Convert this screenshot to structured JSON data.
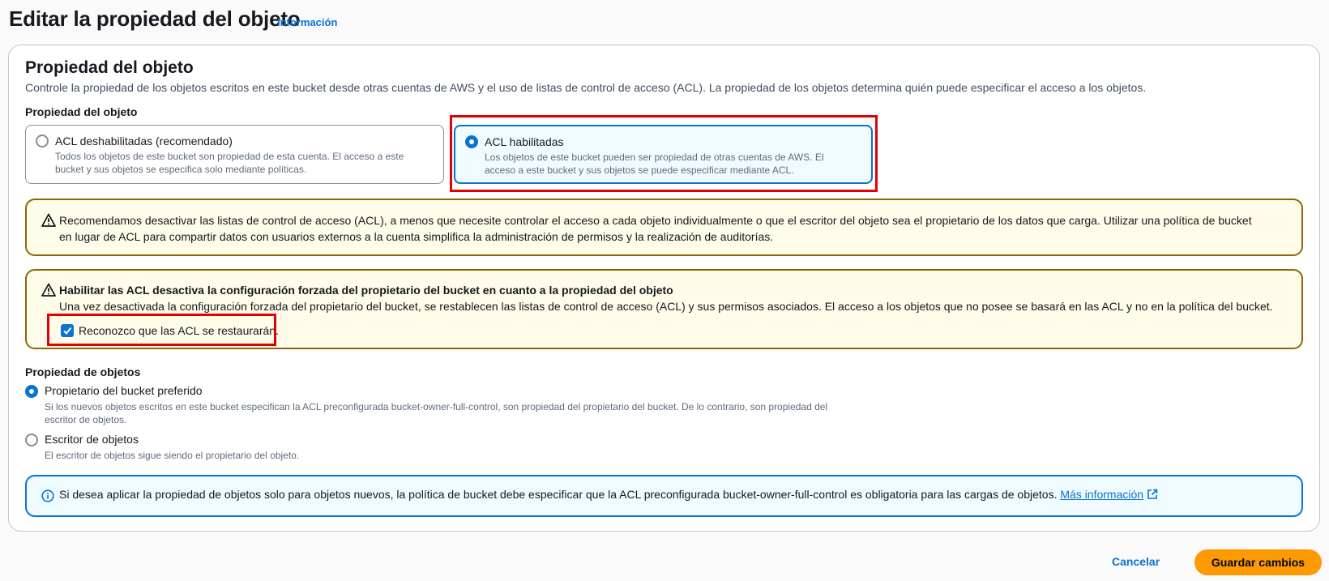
{
  "header": {
    "title": "Editar la propiedad del objeto",
    "info_link": "Información"
  },
  "section": {
    "title": "Propiedad del objeto",
    "description": "Controle la propiedad de los objetos escritos en este bucket desde otras cuentas de AWS y el uso de listas de control de acceso (ACL). La propiedad de los objetos determina quién puede especificar el acceso a los objetos."
  },
  "ownership": {
    "label": "Propiedad del objeto",
    "options": [
      {
        "title": "ACL deshabilitadas (recomendado)",
        "description": "Todos los objetos de este bucket son propiedad de esta cuenta. El acceso a este bucket y sus objetos se especifica solo mediante políticas.",
        "selected": false
      },
      {
        "title": "ACL habilitadas",
        "description": "Los objetos de este bucket pueden ser propiedad de otras cuentas de AWS. El acceso a este bucket y sus objetos se puede especificar mediante ACL.",
        "selected": true
      }
    ]
  },
  "alert_recommend": {
    "line1": "Recomendamos desactivar las listas de control de acceso (ACL), a menos que necesite controlar el acceso a cada objeto individualmente o que el escritor del objeto sea el propietario de los datos que carga. Utilizar una política de bucket",
    "line2": "en lugar de ACL para compartir datos con usuarios externos a la cuenta simplifica la administración de permisos y la realización de auditorías."
  },
  "alert_enable": {
    "title": "Habilitar las ACL desactiva la configuración forzada del propietario del bucket en cuanto a la propiedad del objeto",
    "body": "Una vez desactivada la configuración forzada del propietario del bucket, se restablecen las listas de control de acceso (ACL) y sus permisos asociados. El acceso a los objetos que no posee se basará en las ACL y no en la política del bucket.",
    "checkbox_label": "Reconozco que las ACL se restaurarán.",
    "checked": true
  },
  "object_ownership": {
    "label": "Propiedad de objetos",
    "options": [
      {
        "title": "Propietario del bucket preferido",
        "description_line1": "Si los nuevos objetos escritos en este bucket especifican la ACL preconfigurada bucket-owner-full-control, son propiedad del propietario del bucket. De lo contrario, son propiedad del",
        "description_line2": "escritor de objetos.",
        "selected": true
      },
      {
        "title": "Escritor de objetos",
        "description_line1": "El escritor de objetos sigue siendo el propietario del objeto.",
        "selected": false
      }
    ]
  },
  "info_alert": {
    "text": "Si desea aplicar la propiedad de objetos solo para objetos nuevos, la política de bucket debe especificar que la ACL preconfigurada bucket-owner-full-control es obligatoria para las cargas de objetos.",
    "link": "Más información"
  },
  "footer": {
    "cancel_label": "Cancelar",
    "save_label": "Guardar cambios"
  },
  "colors": {
    "accent": "#0972d3",
    "warning_border": "#8d6605",
    "primary_button": "#ff9900",
    "highlight": "#e30000"
  }
}
